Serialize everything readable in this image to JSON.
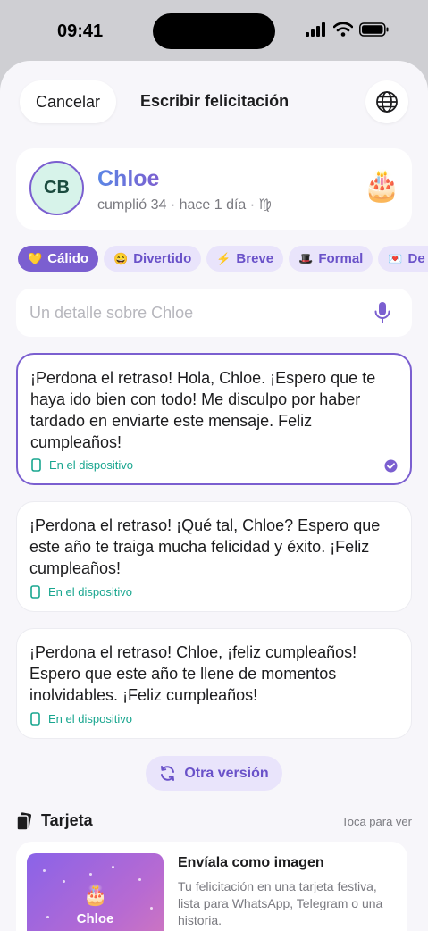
{
  "status_bar": {
    "time": "09:41"
  },
  "nav": {
    "cancel_label": "Cancelar",
    "title": "Escribir felicitación",
    "globe_icon": "globe-icon"
  },
  "profile": {
    "initials": "CB",
    "name": "Chloe",
    "subtitle": "cumplió 34 · hace 1 día · ♍",
    "badge_icon": "birthday-cake-icon"
  },
  "tones": [
    {
      "emoji": "💛",
      "label": "Cálido",
      "selected": true
    },
    {
      "emoji": "😄",
      "label": "Divertido",
      "selected": false
    },
    {
      "emoji": "⚡",
      "label": "Breve",
      "selected": false
    },
    {
      "emoji": "🎩",
      "label": "Formal",
      "selected": false
    },
    {
      "emoji": "💌",
      "label": "De co",
      "selected": false
    }
  ],
  "detail_input": {
    "placeholder": "Un detalle sobre Chloe",
    "value": ""
  },
  "messages": [
    {
      "text": "¡Perdona el retraso! Hola, Chloe. ¡Espero que te haya ido bien con todo! Me disculpo por haber tardado en enviarte este mensaje. Feliz cumpleaños!",
      "tag": "En el dispositivo",
      "selected": true
    },
    {
      "text": "¡Perdona el retraso! ¡Qué tal, Chloe? Espero que este año te traiga mucha felicidad y éxito. ¡Feliz cumpleaños!",
      "tag": "En el dispositivo",
      "selected": false
    },
    {
      "text": "¡Perdona el retraso! Chloe, ¡feliz cumpleaños! Espero que este año te llene de momentos inolvidables. ¡Feliz cumpleaños!",
      "tag": "En el dispositivo",
      "selected": false
    }
  ],
  "other_version_label": "Otra versión",
  "card_section": {
    "title": "Tarjeta",
    "tap_hint": "Toca para ver",
    "preview_title": "Envíala como imagen",
    "preview_desc": "Tu felicitación en una tarjeta festiva, lista para WhatsApp, Telegram o una historia.",
    "thumb_name": "Chloe"
  },
  "colors": {
    "accent": "#7b5fd0",
    "accent_soft": "#e9e4fb",
    "device_tag": "#19a68f",
    "avatar_bg": "#d7f3ea"
  }
}
